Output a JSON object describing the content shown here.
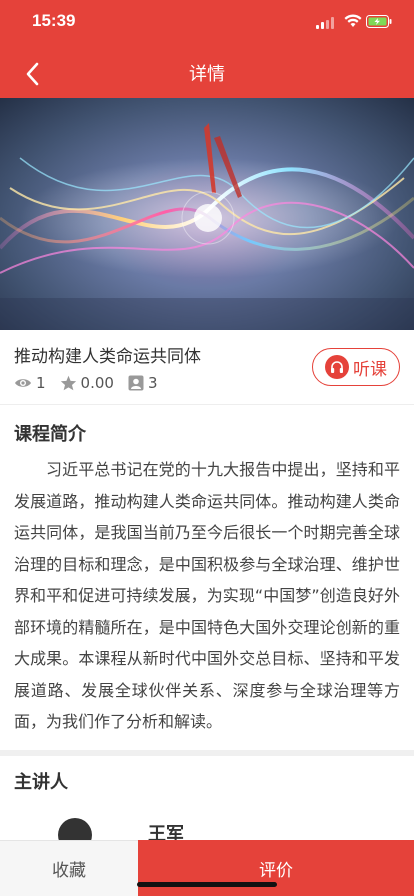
{
  "status_bar": {
    "time": "15:39"
  },
  "nav": {
    "title": "详情"
  },
  "course": {
    "title": "推动构建人类命运共同体",
    "views": "1",
    "rating": "0.00",
    "lessons": "3",
    "listen_label": "听课"
  },
  "intro": {
    "heading": "课程简介",
    "text": "习近平总书记在党的十九大报告中提出，坚持和平发展道路，推动构建人类命运共同体。推动构建人类命运共同体，是我国当前乃至今后很长一个时期完善全球治理的目标和理念，是中国积极参与全球治理、维护世界和平和促进可持续发展，为实现“中国梦”创造良好外部环境的精髓所在，是中国特色大国外交理论创新的重大成果。本课程从新时代中国外交总目标、坚持和平发展道路、发展全球伙伴关系、深度参与全球治理等方面，为我们作了分析和解读。"
  },
  "speaker": {
    "heading": "主讲人",
    "name": "王军"
  },
  "bottom": {
    "favorite_label": "收藏",
    "review_label": "评价"
  },
  "colors": {
    "accent": "#e5423a"
  }
}
